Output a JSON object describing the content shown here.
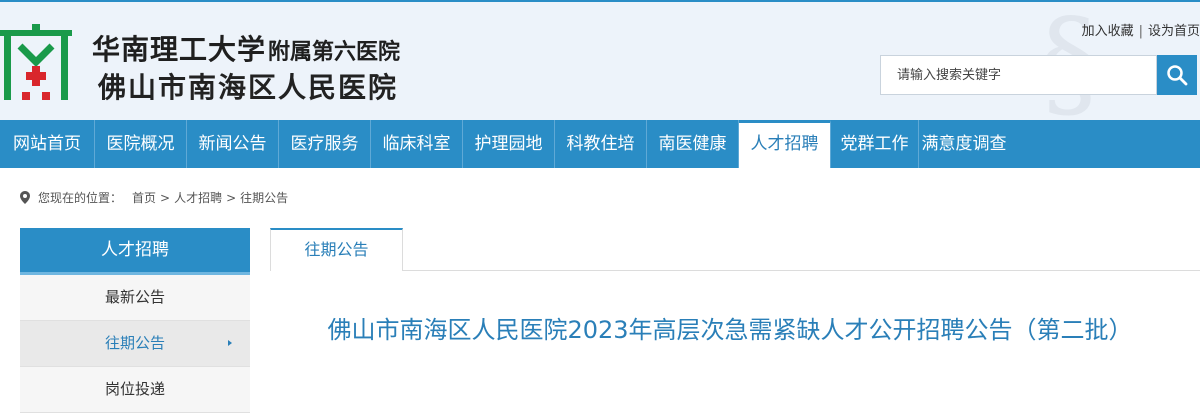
{
  "header": {
    "logo_line1": "华南理工大学",
    "logo_line1_sub": "附属第六医院",
    "logo_line2": "佛山市南海区人民医院",
    "top_links": [
      "加入收藏",
      "设为首页"
    ],
    "link_separator": "|",
    "search_placeholder": "请输入搜索关键字"
  },
  "nav": {
    "items": [
      "网站首页",
      "医院概况",
      "新闻公告",
      "医疗服务",
      "临床科室",
      "护理园地",
      "科教住培",
      "南医健康",
      "人才招聘",
      "党群工作",
      "满意度调查"
    ],
    "active_index": 8
  },
  "breadcrumb": {
    "prefix": "您现在的位置：",
    "items": [
      "首页",
      "人才招聘",
      "往期公告"
    ],
    "separator": ">"
  },
  "sidebar": {
    "title": "人才招聘",
    "items": [
      "最新公告",
      "往期公告",
      "岗位投递"
    ],
    "active_index": 1
  },
  "main": {
    "tab_label": "往期公告",
    "article_title": "佛山市南海区人民医院2023年高层次急需紧缺人才公开招聘公告（第二批）"
  },
  "colors": {
    "primary": "#2a8dc6",
    "text_blue": "#2a7fb8",
    "logo_green": "#1a9a4a",
    "logo_red": "#d9262c"
  }
}
